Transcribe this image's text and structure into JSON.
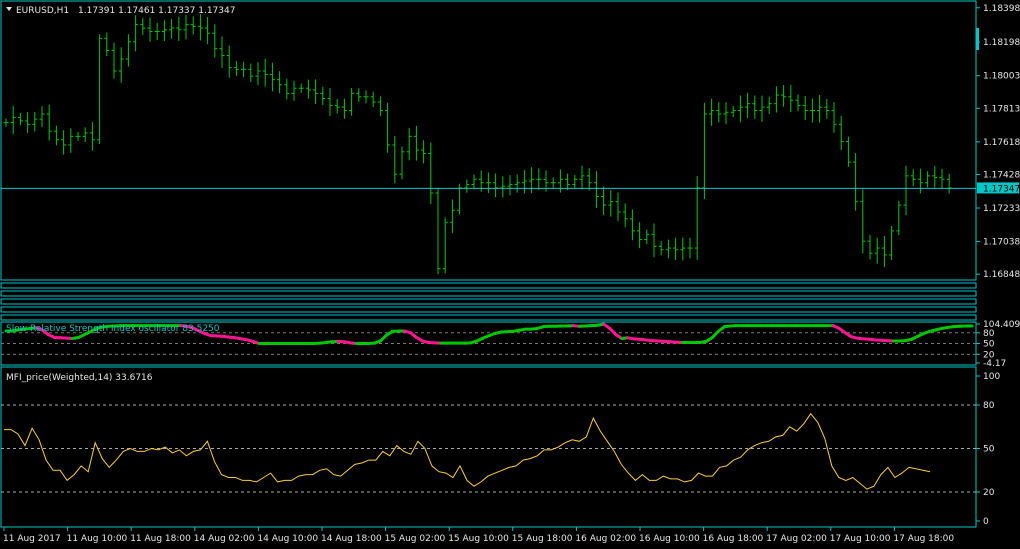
{
  "header": {
    "symbol": "EURUSD,H1",
    "ohlc": "1.17391 1.17461 1.17337 1.17347"
  },
  "colors": {
    "frame": "#00c8c8",
    "bull": "#00c800",
    "bear": "#ff1493",
    "mfi": "#ffcc33",
    "price_line": "#00c8c8",
    "price_tag_bg": "#00c8c8"
  },
  "price_axis": {
    "labels": [
      "1.18398",
      "1.18198",
      "1.18003",
      "1.17813",
      "1.17618",
      "1.17428",
      "1.17233",
      "1.17038",
      "1.16848"
    ],
    "current": "1.17347"
  },
  "rsi": {
    "label": "Slow Relative Strength Index oscillator 83.5250",
    "labels": [
      "104.4095",
      "80",
      "50",
      "20",
      "-4.17"
    ]
  },
  "mfi": {
    "label": "MFI_price(Weighted,14) 33.6716",
    "labels": [
      "100",
      "80",
      "50",
      "20",
      "0"
    ]
  },
  "time_axis": [
    "11 Aug 2017",
    "11 Aug 10:00",
    "11 Aug 18:00",
    "14 Aug 02:00",
    "14 Aug 10:00",
    "14 Aug 18:00",
    "15 Aug 02:00",
    "15 Aug 10:00",
    "15 Aug 18:00",
    "16 Aug 02:00",
    "16 Aug 10:00",
    "16 Aug 18:00",
    "17 Aug 02:00",
    "17 Aug 10:00",
    "17 Aug 18:00"
  ],
  "chart_data": [
    {
      "type": "bar",
      "title": "EURUSD,H1",
      "ylim": [
        1.1682,
        1.1842
      ],
      "current_price": 1.17347,
      "series": [
        {
          "name": "EURUSD,H1",
          "values": [
            1.1773,
            1.1776,
            1.1774,
            1.1772,
            1.1775,
            1.1778,
            1.1768,
            1.1763,
            1.176,
            1.1765,
            1.1765,
            1.1767,
            1.1763,
            1.1822,
            1.1815,
            1.1803,
            1.181,
            1.182,
            1.183,
            1.1828,
            1.1826,
            1.1826,
            1.1827,
            1.1828,
            1.1827,
            1.183,
            1.1829,
            1.1828,
            1.1825,
            1.1816,
            1.1812,
            1.1805,
            1.1804,
            1.1804,
            1.18,
            1.1803,
            1.1801,
            1.1798,
            1.1795,
            1.179,
            1.1793,
            1.1793,
            1.1792,
            1.179,
            1.1787,
            1.1783,
            1.1782,
            1.178,
            1.179,
            1.1788,
            1.1788,
            1.1785,
            1.178,
            1.176,
            1.1743,
            1.1756,
            1.1765,
            1.1757,
            1.1755,
            1.1732,
            1.1688,
            1.1715,
            1.1722,
            1.1735,
            1.1737,
            1.174,
            1.1738,
            1.1738,
            1.1735,
            1.1736,
            1.1737,
            1.1738,
            1.1739,
            1.174,
            1.174,
            1.1738,
            1.1738,
            1.174,
            1.1737,
            1.174,
            1.1742,
            1.1738,
            1.173,
            1.1725,
            1.1727,
            1.1721,
            1.1717,
            1.171,
            1.1705,
            1.1708,
            1.1701,
            1.1699,
            1.17,
            1.1699,
            1.17,
            1.17,
            1.1735,
            1.1778,
            1.178,
            1.1778,
            1.1779,
            1.178,
            1.1782,
            1.1784,
            1.178,
            1.1782,
            1.1784,
            1.1789,
            1.1788,
            1.1786,
            1.1783,
            1.178,
            1.178,
            1.1782,
            1.178,
            1.1772,
            1.1762,
            1.175,
            1.1727,
            1.1704,
            1.1697,
            1.17,
            1.1696,
            1.171,
            1.1725,
            1.1742,
            1.174,
            1.1738,
            1.1742,
            1.1741,
            1.174,
            1.1735
          ]
        }
      ]
    },
    {
      "type": "line",
      "title": "Slow Relative Strength Index oscillator 83.5250",
      "ylim": [
        -4.17,
        104.4095
      ],
      "series": [
        {
          "name": "Slow Relative Strength Index oscillator",
          "values": [
            85,
            85,
            88,
            90,
            92,
            94,
            88,
            75,
            67,
            66,
            65,
            64,
            67,
            75,
            83,
            92,
            96,
            98,
            99,
            100,
            100,
            100,
            100,
            100,
            100,
            100,
            100,
            100,
            100,
            100,
            98,
            93,
            85,
            77,
            72,
            71,
            70,
            68,
            66,
            63,
            60,
            55,
            50,
            50,
            50,
            50,
            50,
            50,
            50,
            50,
            50,
            50,
            51,
            53,
            55,
            56,
            55,
            52,
            50,
            50,
            50,
            51,
            57,
            73,
            84,
            85,
            85,
            80,
            67,
            57,
            53,
            52,
            51,
            51,
            51,
            51,
            51,
            52,
            57,
            65,
            72,
            78,
            82,
            83,
            84,
            87,
            90,
            90,
            92,
            97,
            98,
            98,
            99,
            99,
            100,
            98,
            99,
            100,
            101,
            104,
            92,
            75,
            64,
            66,
            63,
            62,
            60,
            58,
            57,
            56,
            55,
            54,
            53,
            53,
            53,
            53,
            56,
            67,
            84,
            97,
            99,
            100,
            100,
            100,
            100,
            100,
            100,
            100,
            100,
            100,
            100,
            100,
            100,
            100,
            100,
            100,
            100,
            100,
            92,
            80,
            69,
            65,
            63,
            62,
            60,
            59,
            58,
            57,
            57,
            58,
            62,
            70,
            78,
            84,
            88,
            92,
            95,
            97,
            98,
            99,
            99
          ]
        }
      ]
    },
    {
      "type": "line",
      "title": "MFI_price(Weighted,14) 33.6716",
      "ylim": [
        0,
        100
      ],
      "series": [
        {
          "name": "MFI_price(Weighted,14)",
          "values": [
            63,
            63,
            60,
            52,
            64,
            56,
            42,
            35,
            35,
            28,
            32,
            38,
            34,
            54,
            43,
            37,
            42,
            48,
            50,
            48,
            48,
            50,
            49,
            51,
            47,
            49,
            45,
            48,
            49,
            55,
            41,
            32,
            30,
            30,
            28,
            28,
            27,
            30,
            33,
            27,
            28,
            28,
            31,
            32,
            32,
            35,
            36,
            32,
            31,
            35,
            39,
            40,
            42,
            42,
            48,
            45,
            52,
            48,
            46,
            55,
            50,
            38,
            34,
            33,
            30,
            38,
            28,
            24,
            27,
            31,
            33,
            35,
            37,
            38,
            42,
            43,
            45,
            49,
            49,
            51,
            54,
            56,
            55,
            58,
            71,
            62,
            55,
            48,
            39,
            33,
            28,
            32,
            28,
            28,
            31,
            29,
            29,
            27,
            28,
            33,
            31,
            31,
            37,
            38,
            42,
            44,
            49,
            52,
            54,
            55,
            58,
            59,
            65,
            62,
            67,
            74,
            68,
            57,
            38,
            30,
            28,
            30,
            26,
            22,
            24,
            32,
            37,
            30,
            33,
            37,
            36,
            35,
            34
          ]
        }
      ]
    }
  ]
}
